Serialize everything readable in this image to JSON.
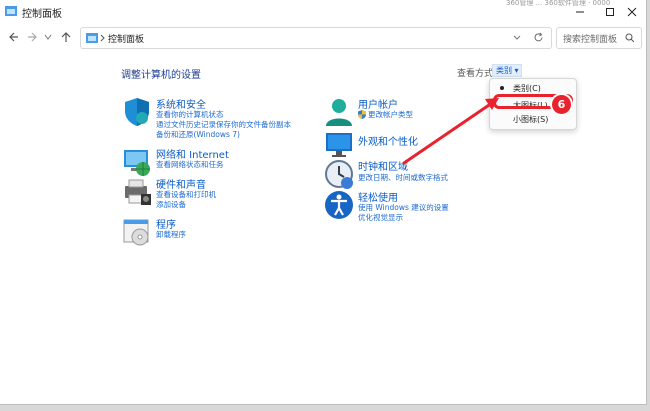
{
  "window": {
    "title": "控制面板",
    "corner_text": "360管理 ... 360软件管理 · 0000"
  },
  "nav": {
    "address": "控制面板",
    "search_placeholder": "搜索控制面板"
  },
  "main": {
    "title": "调整计算机的设置",
    "view_by_label": "查看方式:",
    "view_by_value": "类别 ▾"
  },
  "categories": [
    {
      "title": "系统和安全",
      "links": [
        "查看你的计算机状态",
        "通过文件历史记录保存你的文件备份副本",
        "备份和还原(Windows 7)"
      ],
      "icon": "shield-icon"
    },
    {
      "title": "网络和 Internet",
      "links": [
        "查看网络状态和任务"
      ],
      "icon": "network-icon"
    },
    {
      "title": "硬件和声音",
      "links": [
        "查看设备和打印机",
        "添加设备"
      ],
      "icon": "printer-icon"
    },
    {
      "title": "程序",
      "links": [
        "卸载程序"
      ],
      "icon": "programs-icon"
    },
    {
      "title": "用户帐户",
      "links": [
        "更改帐户类型"
      ],
      "icon": "user-icon"
    },
    {
      "title": "外观和个性化",
      "links": [],
      "icon": "monitor-icon"
    },
    {
      "title": "时钟和区域",
      "links": [
        "更改日期、时间或数字格式"
      ],
      "icon": "clock-icon"
    },
    {
      "title": "轻松使用",
      "links": [
        "使用 Windows 建议的设置",
        "优化视觉显示"
      ],
      "icon": "accessibility-icon"
    }
  ],
  "view_menu": {
    "items": [
      "类别(C)",
      "大图标(L)",
      "小图标(S)"
    ],
    "selected": "类别(C)",
    "highlighted": "大图标(L)"
  },
  "annotation": {
    "step": "6",
    "color": "#e8232d"
  }
}
